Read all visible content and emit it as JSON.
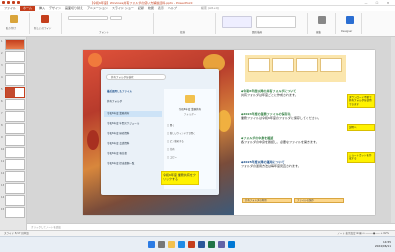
{
  "window": {
    "title": "【令和6年度】Windows共有フォルダの使い方解説資料.pptx - PowerPoint",
    "min_label": "—",
    "max_label": "☐",
    "close_label": "✕"
  },
  "tabs": [
    "ファイル",
    "ホーム",
    "挿入",
    "デザイン",
    "画面切り替え",
    "アニメーション",
    "スライド ショー",
    "記録",
    "校閲",
    "表示",
    "ヘルプ"
  ],
  "active_tab": "ホーム",
  "search_placeholder": "検索 (Alt+Q)",
  "ribbon": {
    "labels": [
      "貼り付け",
      "新しいスライド",
      "フォント",
      "段落",
      "図形描画",
      "編集",
      "Designer"
    ]
  },
  "slides_panel": {
    "numbers": [
      "1",
      "2",
      "3",
      "4",
      "5",
      "6",
      "7",
      "8",
      "9",
      "10",
      "11",
      "12",
      "13",
      "14",
      "15",
      "16",
      "17"
    ]
  },
  "slide": {
    "explorer": {
      "search": "共有フォルダを検索",
      "items": [
        {
          "label": "最近使用したファイル",
          "header": true
        },
        {
          "label": "共有フォルダ",
          "header": false
        },
        {
          "label": "令和6年度 業務共有",
          "header": false
        },
        {
          "label": "令和6年度 年間スケジュール",
          "header": false
        },
        {
          "label": "令和6年度 研修資料",
          "header": false
        },
        {
          "label": "令和6年度 会議資料",
          "header": false
        },
        {
          "label": "令和6年度 報告書",
          "header": false
        },
        {
          "label": "令和6年度 提出書類一覧",
          "header": false
        }
      ],
      "preview_title": "令和6年度 業務共有",
      "preview_sub": "フォルダー",
      "preview_items": [
        "□ 開く",
        "□ 新しいウィンドウで開く",
        "□ ピン留めする",
        "□ 共有",
        "□ コピー"
      ]
    },
    "yellow_note": "令和6年度 業務共有をクリックする",
    "bullets": [
      {
        "heading": "◆令和6年度以降の共有フォルダについて",
        "text": "共有フォルダは年度ごとに作成されます。"
      },
      {
        "heading": "◆2024年度の業務ファイルの保存先",
        "text": "業務ファイルは令和6年度のフォルダに保存してください。"
      },
      {
        "heading": "◆フォルダの中身を確認",
        "text": "各フォルダの中身を確認し、必要なファイルを開きます。"
      },
      {
        "heading": "◆2025年度以降の運用について",
        "text": "フォルダの運用方法は毎年度見直されます。"
      }
    ],
    "callouts": [
      "ダウンロード不要で共有フォルダを使用できます",
      "説明へ",
      "ショートカットを作成する"
    ],
    "table": [
      "共有フォルダの利用",
      "ファイルの保存"
    ]
  },
  "notes_placeholder": "クリックしてノートを追加",
  "status": {
    "left": "スライド 5/17  日本語",
    "right": "ノート  表示設定  ⊞  ▦  ▭  ─────●───  +  62%"
  },
  "taskbar": {
    "time": "14:55",
    "date": "2024/06/11"
  },
  "colors": {
    "accent": "#c43e1c",
    "yellow": "#fff200"
  }
}
